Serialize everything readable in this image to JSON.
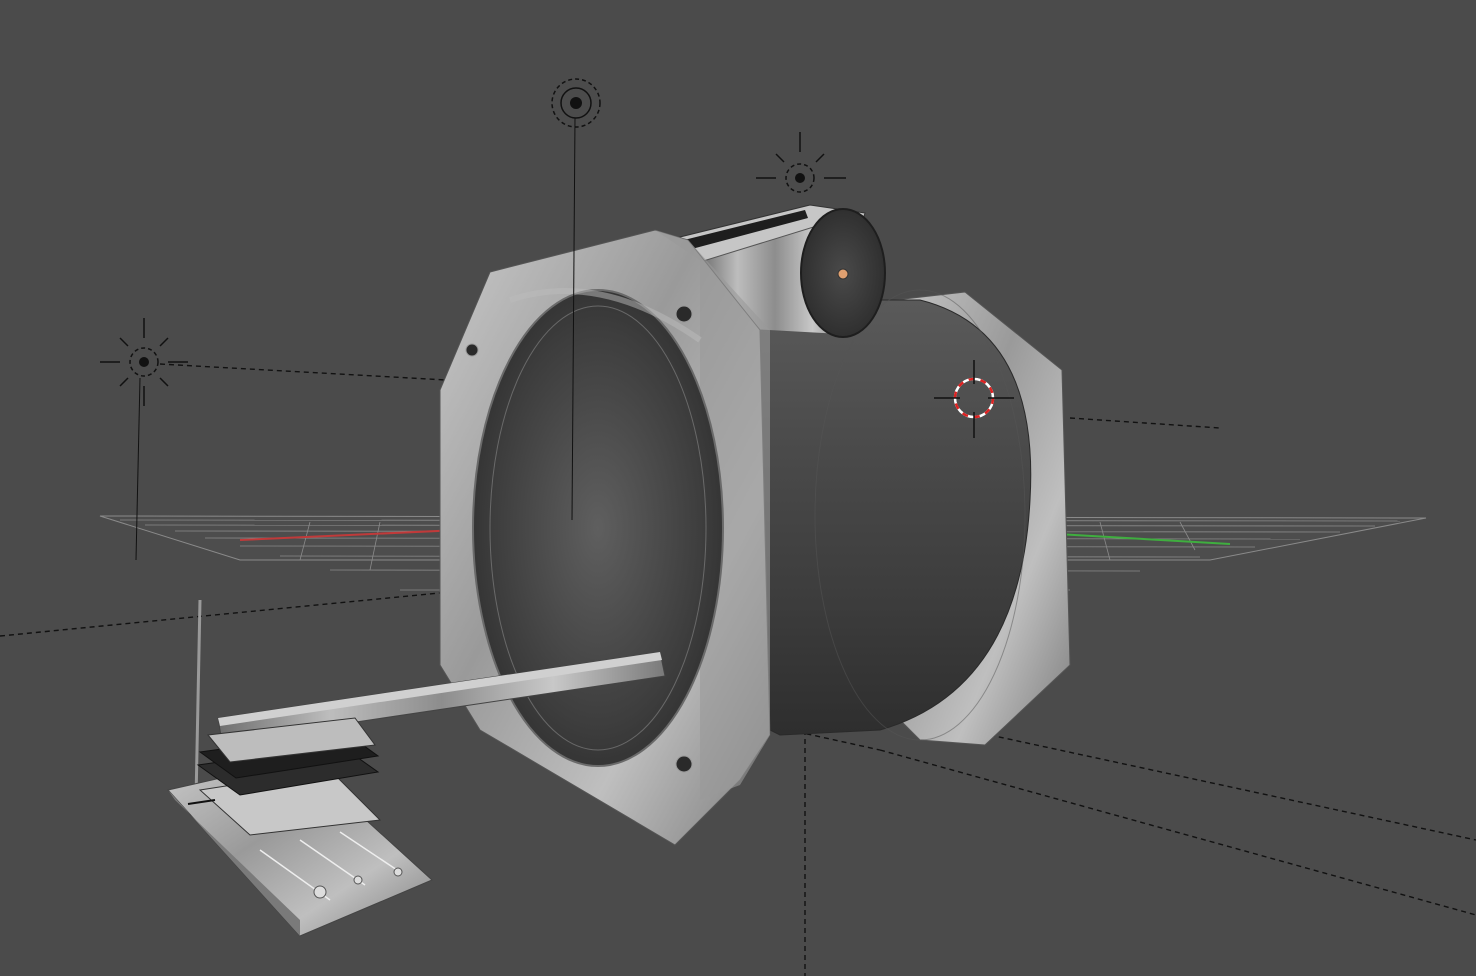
{
  "viewport": {
    "background": "#4b4b4b",
    "grid_color": "#8a8a8a",
    "x_axis_color": "#c03a3a",
    "y_axis_color": "#3fae3f"
  },
  "objects": {
    "lamps": [
      {
        "name": "lamp-left",
        "type": "sun",
        "icon": "sun-lamp-icon"
      },
      {
        "name": "lamp-top",
        "type": "point",
        "icon": "point-lamp-icon"
      },
      {
        "name": "lamp-right",
        "type": "sun",
        "icon": "sun-lamp-icon"
      }
    ],
    "cursor": {
      "icon": "3d-cursor-icon"
    },
    "models": [
      "scanner-bore-housing",
      "front-ring-flange",
      "back-ring-flange",
      "top-cylinder-accessory",
      "patient-table-rail",
      "patient-table-assembly"
    ]
  }
}
